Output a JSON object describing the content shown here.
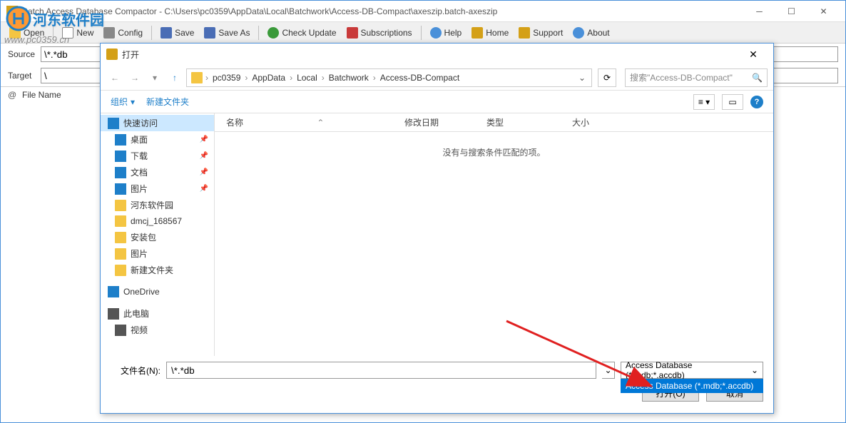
{
  "window": {
    "title": "Batch Access Database Compactor - C:\\Users\\pc0359\\AppData\\Local\\Batchwork\\Access-DB-Compact\\axeszip.batch-axeszip"
  },
  "watermark": {
    "brand": "河东软件园",
    "url": "www.pc0359.cn"
  },
  "toolbar": {
    "open": "Open",
    "new": "New",
    "config": "Config",
    "save": "Save",
    "save_as": "Save As",
    "check_update": "Check Update",
    "subscriptions": "Subscriptions",
    "help": "Help",
    "home": "Home",
    "support": "Support",
    "about": "About"
  },
  "paths": {
    "source_label": "Source",
    "source_value": "\\*.*db",
    "target_label": "Target",
    "target_value": "\\"
  },
  "list": {
    "at": "@",
    "filename": "File Name"
  },
  "dialog": {
    "title": "打开",
    "breadcrumb": [
      "pc0359",
      "AppData",
      "Local",
      "Batchwork",
      "Access-DB-Compact"
    ],
    "search_placeholder": "搜索\"Access-DB-Compact\"",
    "organize": "组织",
    "new_folder": "新建文件夹",
    "columns": {
      "name": "名称",
      "date": "修改日期",
      "type": "类型",
      "size": "大小"
    },
    "empty": "没有与搜索条件匹配的项。",
    "sidebar": [
      {
        "label": "快速访问",
        "icon": "star",
        "top": true,
        "selected": true
      },
      {
        "label": "桌面",
        "icon": "desktop",
        "pin": true
      },
      {
        "label": "下载",
        "icon": "download",
        "pin": true
      },
      {
        "label": "文档",
        "icon": "doc",
        "pin": true
      },
      {
        "label": "图片",
        "icon": "pic",
        "pin": true
      },
      {
        "label": "河东软件园",
        "icon": "folder"
      },
      {
        "label": "dmcj_168567",
        "icon": "folder"
      },
      {
        "label": "安装包",
        "icon": "folder"
      },
      {
        "label": "图片",
        "icon": "folder"
      },
      {
        "label": "新建文件夹",
        "icon": "folder"
      },
      {
        "label": "OneDrive",
        "icon": "cloud",
        "top": true
      },
      {
        "label": "此电脑",
        "icon": "pc",
        "top": true
      },
      {
        "label": "视频",
        "icon": "video"
      }
    ],
    "filename_label": "文件名(N):",
    "filename_value": "\\*.*db",
    "filter_selected": "Access Database (*.mdb;*.accdb)",
    "filter_option": "Access Database (*.mdb;*.accdb)",
    "open_btn": "打开(O)",
    "cancel_btn": "取消"
  }
}
